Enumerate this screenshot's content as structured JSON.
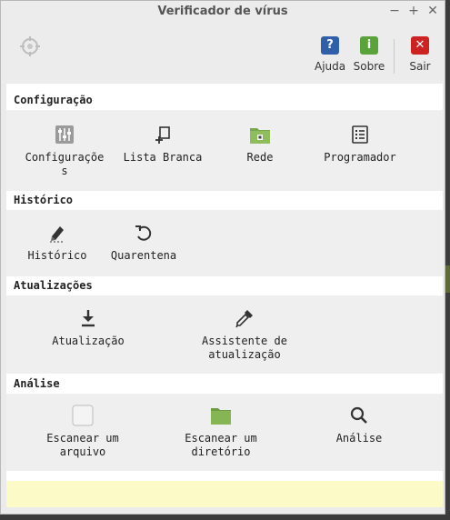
{
  "window": {
    "title": "Verificador de vírus"
  },
  "window_controls": {
    "minimize": "−",
    "maximize": "+",
    "close": "✕"
  },
  "toolbar": {
    "help_label": "Ajuda",
    "help_glyph": "?",
    "about_label": "Sobre",
    "about_glyph": "i",
    "quit_label": "Sair",
    "quit_glyph": "✕"
  },
  "sections": [
    {
      "title": "Configuração",
      "items": [
        {
          "label": "Configuraçõe\ns",
          "icon": "sliders-icon"
        },
        {
          "label": "Lista Branca",
          "icon": "whitelist-icon"
        },
        {
          "label": "Rede",
          "icon": "network-folder-icon"
        },
        {
          "label": "Programador",
          "icon": "scheduler-icon"
        }
      ]
    },
    {
      "title": "Histórico",
      "items": [
        {
          "label": "Histórico",
          "icon": "history-icon"
        },
        {
          "label": "Quarentena",
          "icon": "quarantine-icon"
        }
      ]
    },
    {
      "title": "Atualizações",
      "items": [
        {
          "label": "Atualização",
          "icon": "download-icon"
        },
        {
          "label": "Assistente de\natualização",
          "icon": "eyedropper-icon"
        }
      ]
    },
    {
      "title": "Análise",
      "items": [
        {
          "label": "Escanear um\narquivo",
          "icon": "file-icon"
        },
        {
          "label": "Escanear um\ndiretório",
          "icon": "folder-icon"
        },
        {
          "label": "Análise",
          "icon": "search-icon"
        }
      ]
    }
  ],
  "colors": {
    "help": "#2f5fa8",
    "about": "#5aa33a",
    "quit": "#cc2222",
    "footer": "#fcfac6",
    "folder": "#78a84c"
  }
}
